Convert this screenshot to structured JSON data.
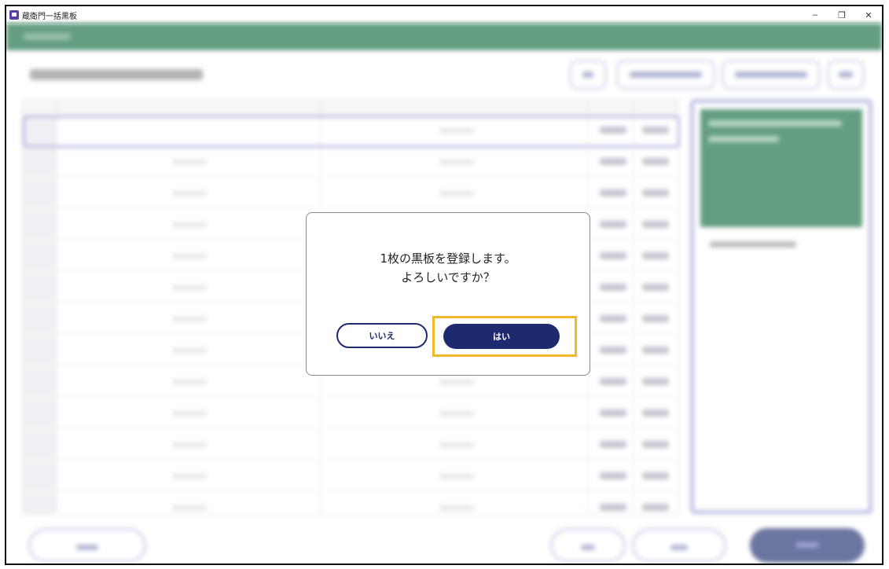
{
  "window": {
    "title": "蔵衛門一括黒板",
    "minimize_icon": "–",
    "maximize_icon": "❐",
    "close_icon": "✕"
  },
  "dialog": {
    "message_line1": "1枚の黒板を登録します。",
    "message_line2": "よろしいですか？",
    "no_label": "いいえ",
    "yes_label": "はい"
  },
  "colors": {
    "header_green": "#116a3e",
    "primary_navy": "#1e2a6e",
    "highlight_yellow": "#f0b928"
  }
}
